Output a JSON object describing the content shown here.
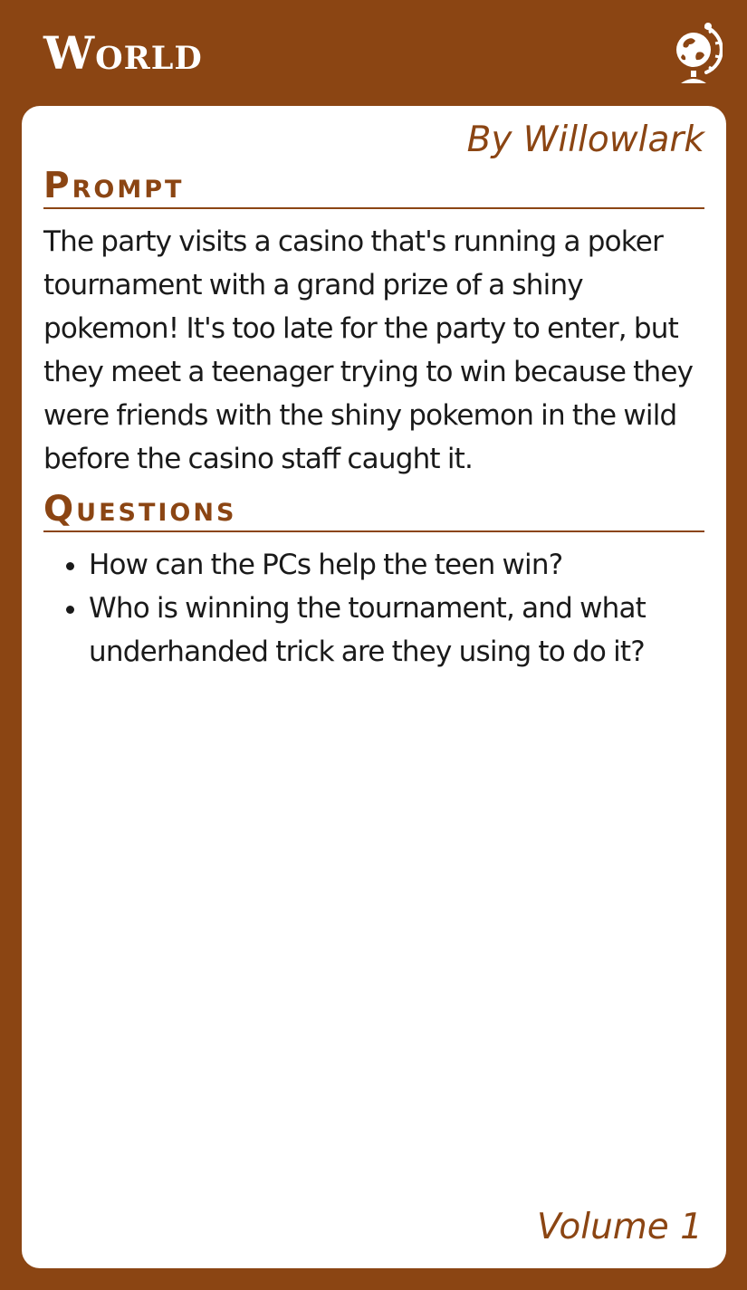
{
  "card": {
    "category": "World",
    "category_icon": "globe-icon",
    "author": "By Willowlark",
    "volume": "Volume 1"
  },
  "prompt": {
    "heading": "Prompt",
    "text": "The party visits a casino that's running a poker tournament with a grand prize of a shiny pokemon! It's too late for the party to enter, but they meet a teenager trying to win because they were friends with the shiny pokemon in the wild before the casino staff caught it."
  },
  "questions": {
    "heading": "Questions",
    "items": [
      "How can the PCs help the teen win?",
      "Who is winning the tournament, and what underhanded trick are they using to do it?"
    ]
  },
  "colors": {
    "frame": "#8b4513",
    "panel": "#ffffff",
    "accent_text": "#8b4513",
    "body_text": "#1a1a1a"
  }
}
